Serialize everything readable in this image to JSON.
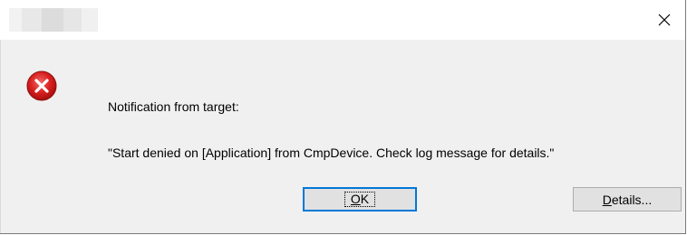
{
  "dialog": {
    "close_icon": "close-icon",
    "icon": "error-icon",
    "message_line1": "Notification from target:",
    "message_line2": "\"Start denied on [Application] from CmpDevice. Check log message for details.\"",
    "ok_label": "OK",
    "details_label": "Details...",
    "accent_color": "#0078d7",
    "error_color": "#d32f2f"
  }
}
